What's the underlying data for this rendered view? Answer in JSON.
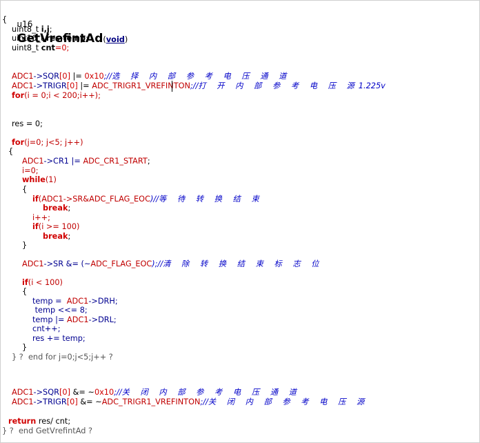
{
  "editor": {
    "lines": {
      "sig_ret": "u16",
      "sig_name": "GetVrefintAd",
      "sig_void": "void",
      "open_brace": "{",
      "decl1": "uint8_t ",
      "decl1_vars": "i,j",
      "decl2": "uint16_t ",
      "decl2_vars": "res,temp",
      "decl3": "uint8_t ",
      "decl3_var": "cnt",
      "decl3_init": "=0;",
      "sqr_a": "ADC1",
      "sqr_b": "->SQR",
      "sqr_c": "[0]",
      "sqr_d": " |= ",
      "sqr_e": "0x10",
      "sqr_f": ";//",
      "sqr_cmt": "选 择 内 部 参 考 电 压 通 道",
      "trig_a": "ADC1",
      "trig_b": "->TRIGR",
      "trig_c": "[0]",
      "trig_d": " |= ",
      "trig_e": "ADC_TRIGR1_VREFINTON",
      "trig_f": ";//",
      "trig_cmt": "打 开 内 部 参 考 电 压 源",
      "trig_cmt2": "1.225v",
      "for1_kw": "for",
      "for1_body": "(i = 0;i < 200;i++);",
      "res_line": "res = 0;",
      "for2_kw": "for",
      "for2_body": "(j=0; j<5; j++)",
      "brace_open2": "{",
      "cr1_a": "ADC1",
      "cr1_b": "->CR1 |= ",
      "cr1_c": "ADC_CR1_START",
      "cr1_d": ";",
      "i_zero": "i=0;",
      "while_kw": "while",
      "while_body": "(1)",
      "brace_open3": "{",
      "if1_kw": "if",
      "if1_body_a": "(ADC1",
      "if1_body_b": "->SR&ADC_FLAG_EOC",
      "if1_body_c": ")//",
      "if1_cmt": "等 待 转 换 结 束",
      "break1": "break",
      "semicolon": ";",
      "i_inc": "i++;",
      "if2_kw": "if",
      "if2_body": "(i >= 100)",
      "break2": "break",
      "brace_close3": "}",
      "sr_a": "ADC1",
      "sr_b": "->SR &= (~",
      "sr_c": "ADC_FLAG_EOC",
      "sr_d": ");//",
      "sr_cmt": "清 除 转 换 结 束 标 志 位",
      "if3_kw": "if",
      "if3_body": "(i < 100)",
      "brace_open4": "{",
      "temp1": "temp =  ",
      "temp1_b": "ADC1",
      "temp1_c": "->DRH;",
      "temp2": " temp <<= 8;",
      "temp3": "temp |= ",
      "temp3_b": "ADC1",
      "temp3_c": "->DRL;",
      "cnt_inc": "cnt++;",
      "res_add": "res += temp;",
      "brace_close4": "}",
      "end_for": "} ?  end for j=0;j<5;j++ ?",
      "sqr2_a": "ADC1",
      "sqr2_b": "->SQR",
      "sqr2_c": "[0]",
      "sqr2_d": " &= ~",
      "sqr2_e": "0x10",
      "sqr2_f": ";//",
      "sqr2_cmt": "关 闭 内 部 参 考 电 压 通 道",
      "trig2_a": "ADC1",
      "trig2_b": "->TRIGR",
      "trig2_c": "[0]",
      "trig2_d": " &= ~",
      "trig2_e": "ADC_TRIGR1_VREFINTON",
      "trig2_f": ";//",
      "trig2_cmt": "关 闭 内 部 参 考 电 压 源",
      "return_kw": "return",
      "return_body": " res/ cnt;",
      "end_func": "} ?  end GetVrefintAd ?"
    }
  },
  "colors": {
    "keyword": "#d00000",
    "identifier": "#c00000",
    "comment": "#0000c8",
    "text": "#000000"
  }
}
